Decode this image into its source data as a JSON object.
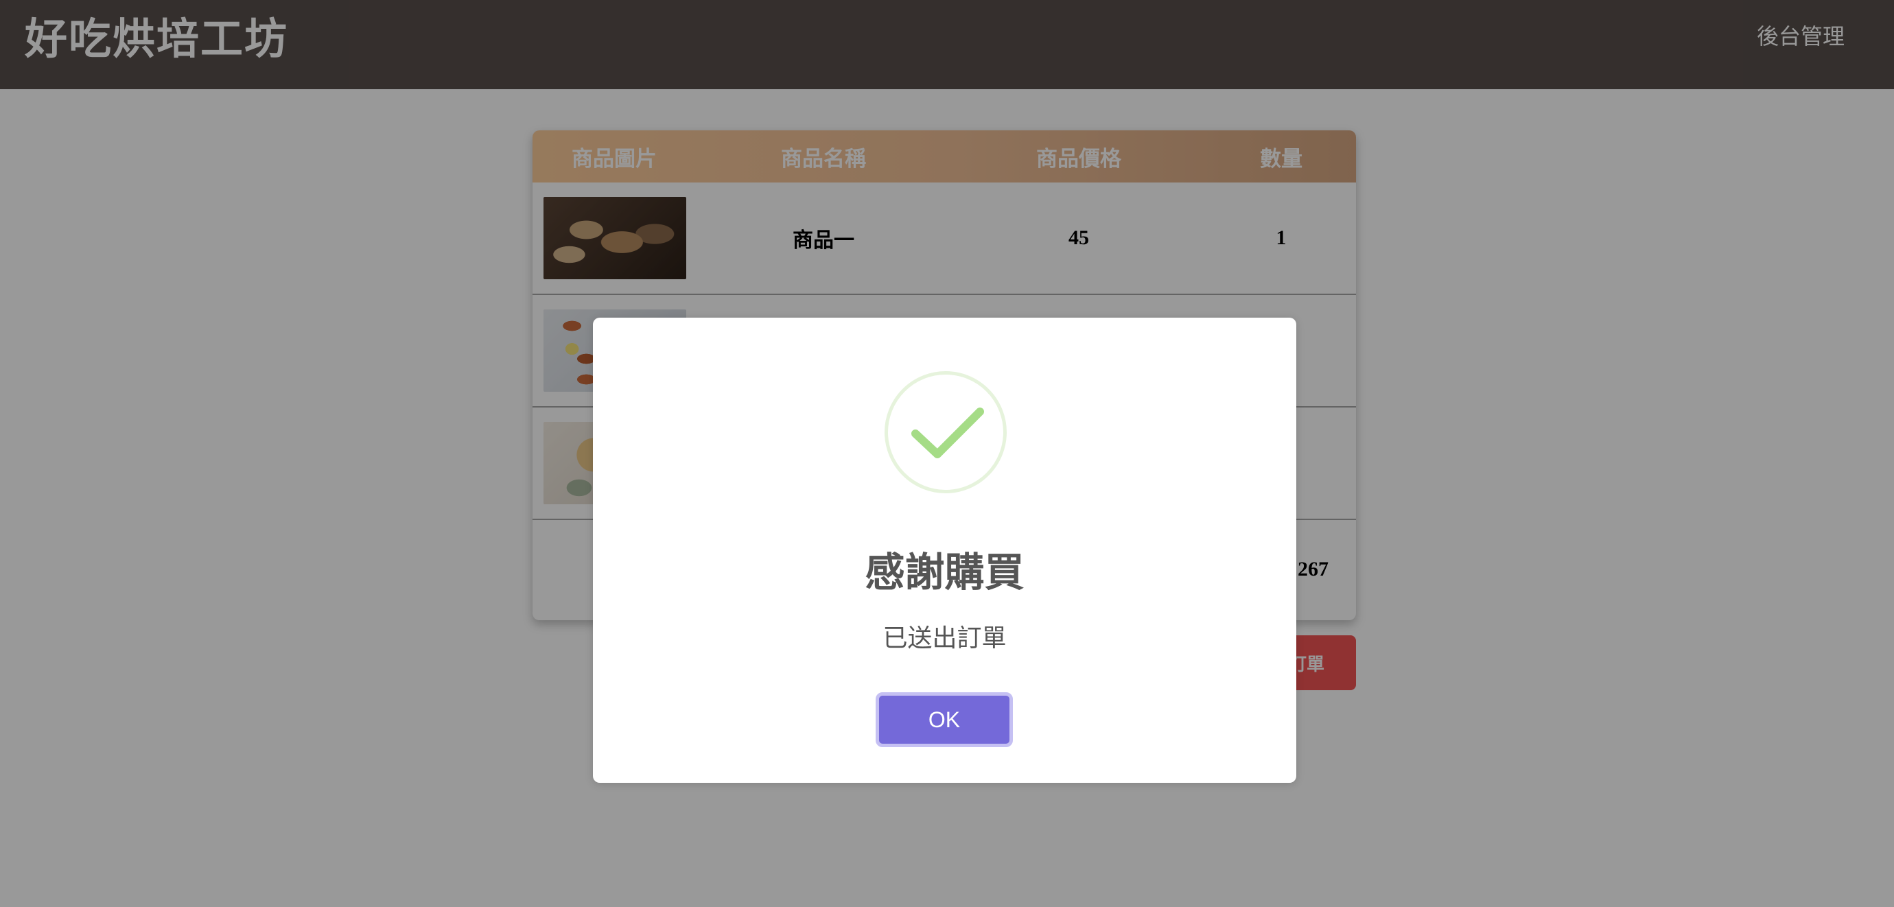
{
  "header": {
    "brand": "好吃烘培工坊",
    "admin_link": "後台管理"
  },
  "cart": {
    "columns": [
      "商品圖片",
      "商品名稱",
      "商品價格",
      "數量"
    ],
    "rows": [
      {
        "image": "bread-slices-photo",
        "name": "商品一",
        "price": "45",
        "qty": "1"
      },
      {
        "image": "pastries-photo",
        "name": "",
        "price": "",
        "qty": ""
      },
      {
        "image": "croissant-photo",
        "name": "",
        "price": "",
        "qty": ""
      }
    ],
    "total": "267",
    "submit_label": "訂單"
  },
  "modal": {
    "icon": "success-check-icon",
    "title": "感謝購買",
    "text": "已送出訂單",
    "ok_label": "OK"
  },
  "colors": {
    "header_bg": "#584f4b",
    "table_header": "#efbf97",
    "submit_button": "#f05454",
    "ok_button": "#7469d9",
    "check_green": "#a5dc86"
  }
}
